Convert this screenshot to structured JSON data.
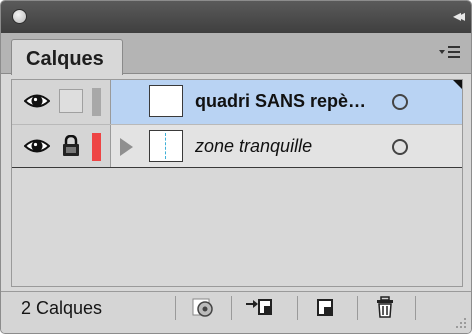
{
  "panel": {
    "tab_label": "Calques",
    "footer_count": "2 Calques"
  },
  "layers": [
    {
      "name": "quadri SANS repè…",
      "visible": true,
      "locked": false,
      "color": "#a8a8a8",
      "selected": true
    },
    {
      "name": "zone tranquille",
      "visible": true,
      "locked": true,
      "color": "#ee4444",
      "selected": false
    }
  ],
  "icons": {
    "collapse": "double-chevron-left-icon",
    "menu": "panel-menu-icon",
    "eye": "eye-icon",
    "lock": "lock-icon",
    "target": "target-circle-icon",
    "make_clip": "clipping-mask-icon",
    "sublayer": "new-sublayer-icon",
    "new_layer": "new-layer-icon",
    "trash": "trash-icon"
  },
  "colors": {
    "selection": "#b9d3f3",
    "panel_bg": "#d8d8d8",
    "title_bg": "#4a4a4a"
  }
}
